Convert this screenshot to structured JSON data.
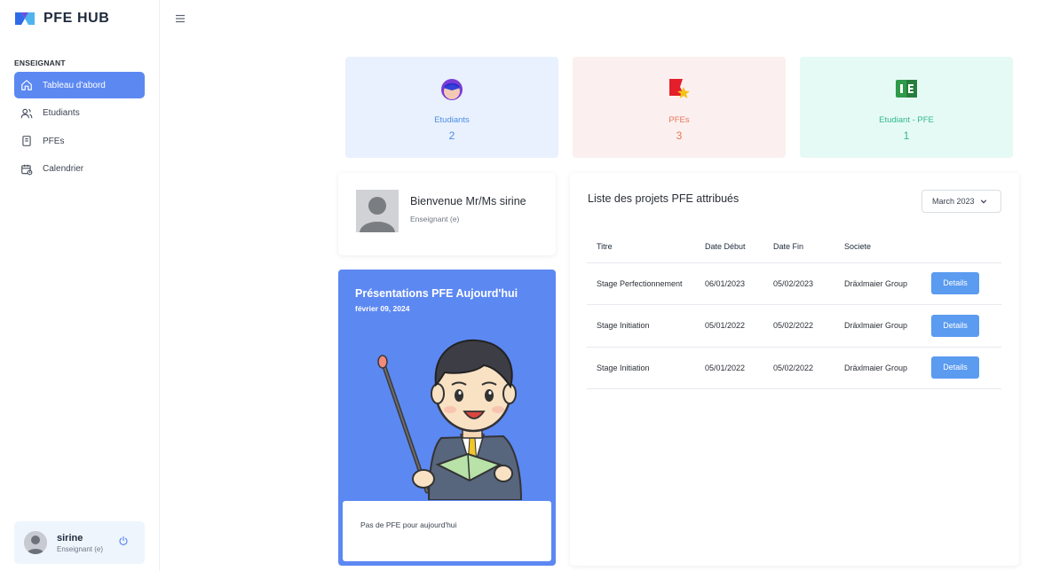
{
  "app": {
    "name": "PFE HUB"
  },
  "sidebar": {
    "section": "ENSEIGNANT",
    "items": [
      {
        "label": "Tableau d'abord",
        "icon": "home-icon",
        "active": true
      },
      {
        "label": "Etudiants",
        "icon": "users-icon",
        "active": false
      },
      {
        "label": "PFEs",
        "icon": "book-icon",
        "active": false
      },
      {
        "label": "Calendrier",
        "icon": "calendar-icon",
        "active": false
      }
    ],
    "user": {
      "name": "sirine",
      "role": "Enseignant (e)"
    }
  },
  "stats": [
    {
      "label": "Etudiants",
      "value": "2",
      "color": "#4d8de3",
      "bg": "#e8f1fd",
      "icon": "student-icon"
    },
    {
      "label": "PFEs",
      "value": "3",
      "color": "#e8745a",
      "bg": "#fbf0ef",
      "icon": "star-flag-icon"
    },
    {
      "label": "Etudiant - PFE",
      "value": "1",
      "color": "#2fb98a",
      "bg": "#e6faf5",
      "icon": "id-card-icon"
    }
  ],
  "welcome": {
    "title": "Bienvenue Mr/Ms sirine",
    "subtitle": "Enseignant (e)"
  },
  "presentations": {
    "title": "Présentations PFE Aujourd'hui",
    "date": "février 09, 2024",
    "empty_message": "Pas de PFE pour aujourd'hui"
  },
  "projects": {
    "title": "Liste des projets PFE attribués",
    "month": "March 2023",
    "columns": [
      "Titre",
      "Date Début",
      "Date Fin",
      "Societe"
    ],
    "rows": [
      {
        "titre": "Stage Perfectionnement",
        "debut": "06/01/2023",
        "fin": "05/02/2023",
        "societe": "Dräxlmaier Group",
        "action": "Details"
      },
      {
        "titre": "Stage Initiation",
        "debut": "05/01/2022",
        "fin": "05/02/2022",
        "societe": "Dräxlmaier Group",
        "action": "Details"
      },
      {
        "titre": "Stage Initiation",
        "debut": "05/01/2022",
        "fin": "05/02/2022",
        "societe": "Dräxlmaier Group",
        "action": "Details"
      }
    ]
  },
  "colors": {
    "accent": "#5c88f2",
    "button": "#5b9bf0"
  }
}
